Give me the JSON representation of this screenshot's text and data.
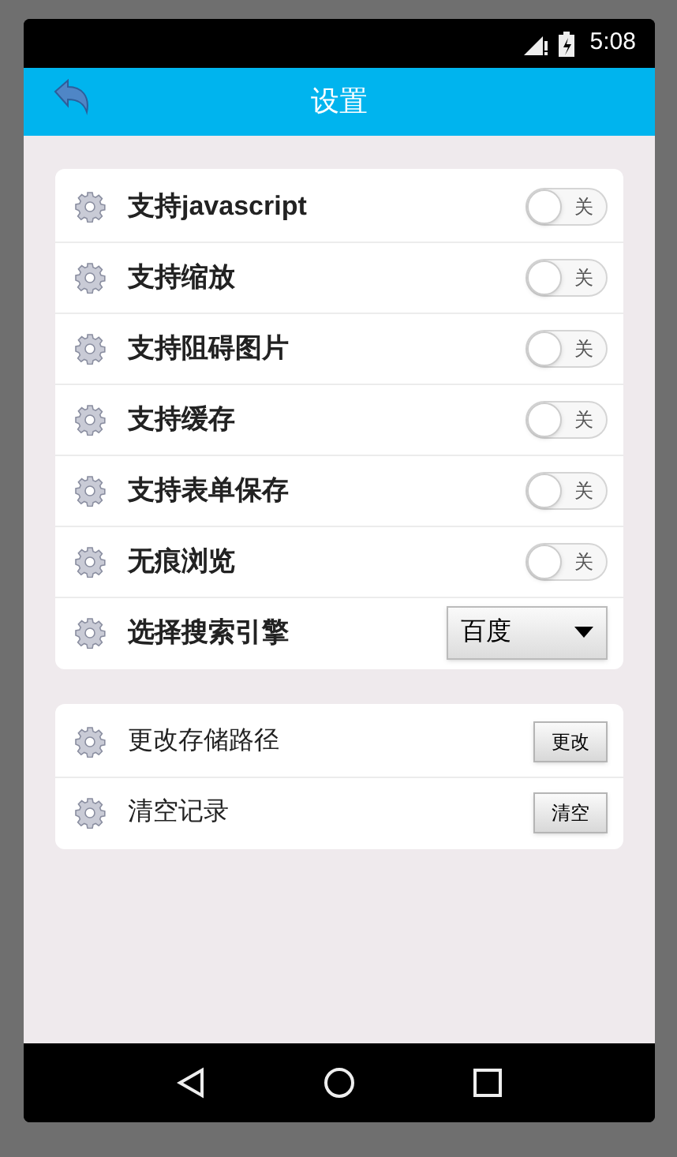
{
  "status_bar": {
    "time": "5:08"
  },
  "app_bar": {
    "title": "设置"
  },
  "groups": [
    {
      "rows": [
        {
          "kind": "toggle",
          "label": "支持javascript",
          "on": false,
          "toggle_text": "关"
        },
        {
          "kind": "toggle",
          "label": "支持缩放",
          "on": false,
          "toggle_text": "关"
        },
        {
          "kind": "toggle",
          "label": "支持阻碍图片",
          "on": false,
          "toggle_text": "关"
        },
        {
          "kind": "toggle",
          "label": "支持缓存",
          "on": false,
          "toggle_text": "关"
        },
        {
          "kind": "toggle",
          "label": "支持表单保存",
          "on": false,
          "toggle_text": "关"
        },
        {
          "kind": "toggle",
          "label": "无痕浏览",
          "on": false,
          "toggle_text": "关"
        },
        {
          "kind": "dropdown",
          "label": "选择搜索引擎",
          "value": "百度"
        }
      ]
    },
    {
      "rows": [
        {
          "kind": "button",
          "label": "更改存储路径",
          "button": "更改"
        },
        {
          "kind": "button",
          "label": "清空记录",
          "button": "清空"
        }
      ]
    }
  ]
}
